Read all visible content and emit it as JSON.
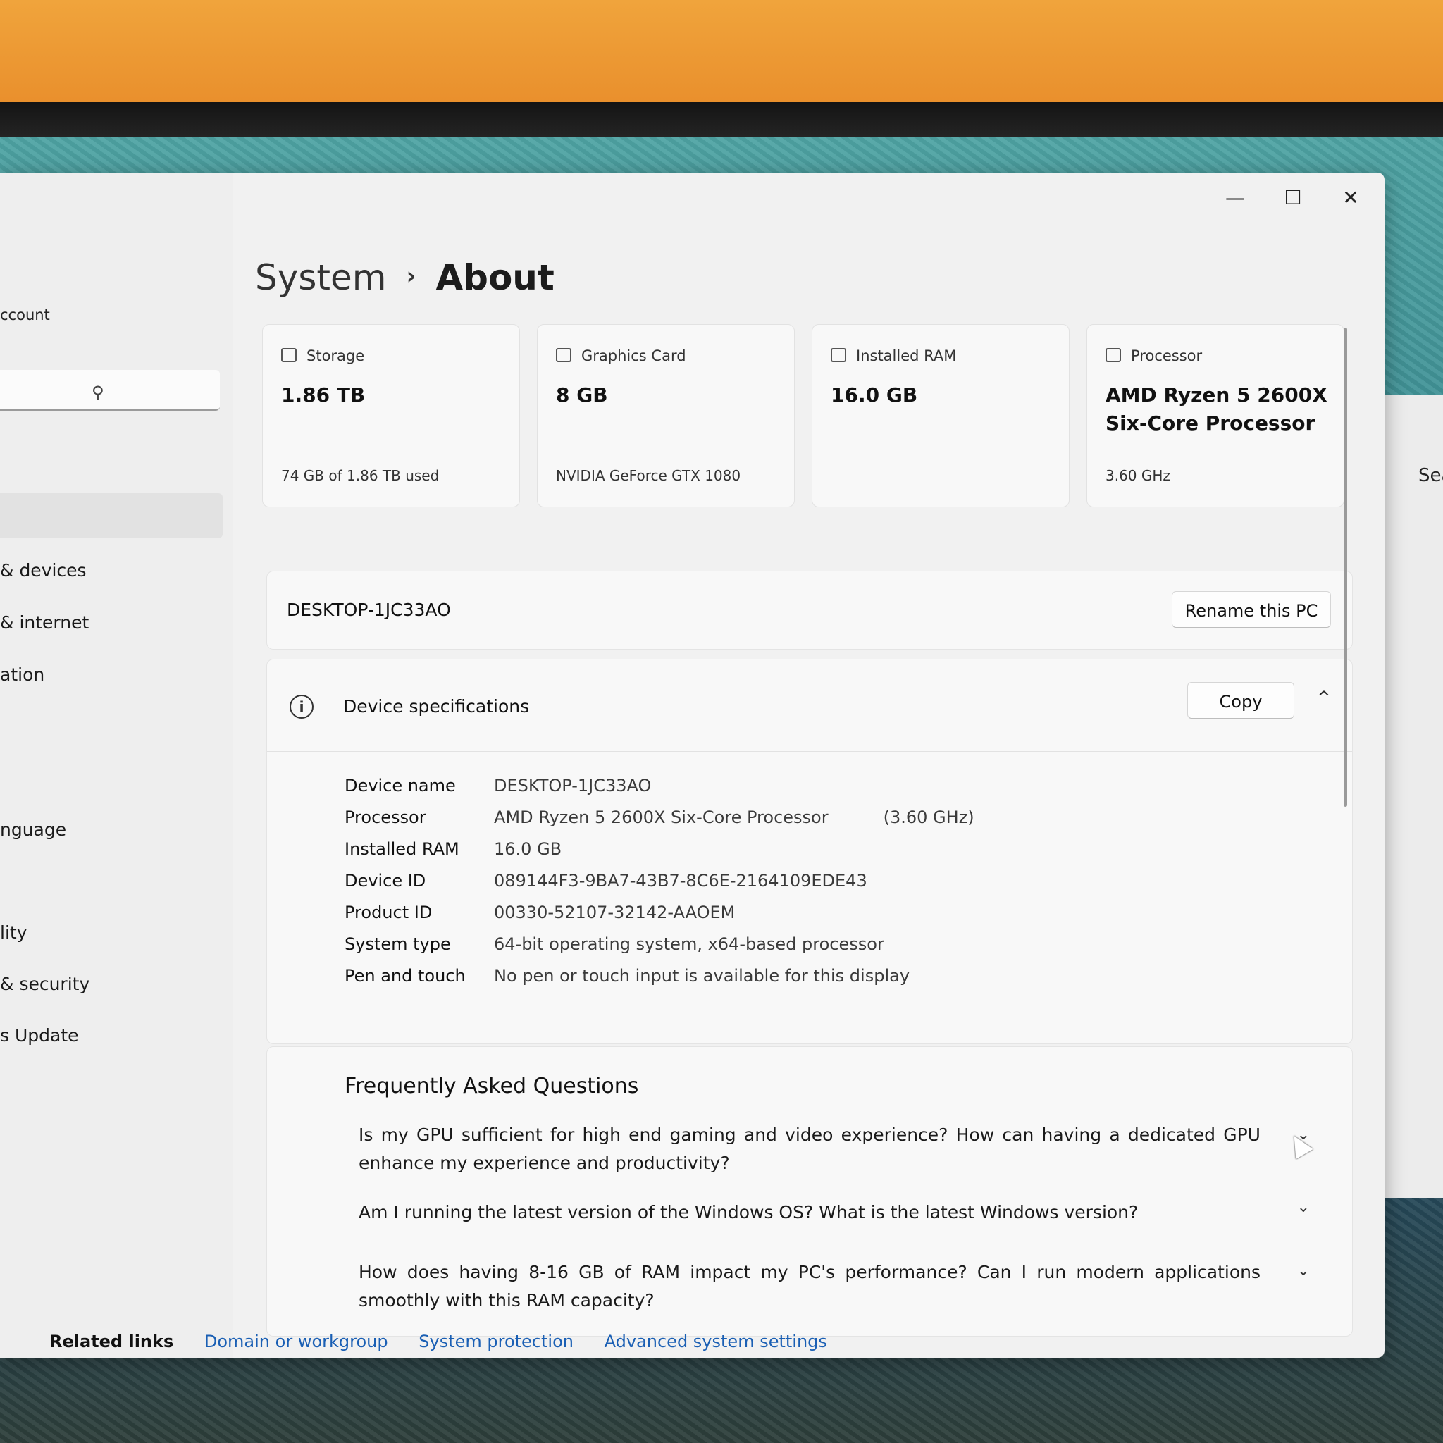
{
  "sidebar": {
    "account": "ccount",
    "items": [
      "& devices",
      "& internet",
      "ation",
      "nguage",
      "lity",
      "& security",
      "s Update"
    ]
  },
  "behind_window": {
    "text": "Sea"
  },
  "breadcrumb": {
    "parent": "System",
    "separator": "›",
    "current": "About"
  },
  "caption": {
    "minimize": "—",
    "maximize": "☐",
    "close": "✕"
  },
  "cards": [
    {
      "label": "Storage",
      "value": "1.86 TB",
      "sub": "74 GB of 1.86 TB used"
    },
    {
      "label": "Graphics Card",
      "value": "8 GB",
      "sub": "NVIDIA GeForce GTX 1080"
    },
    {
      "label": "Installed RAM",
      "value": "16.0 GB",
      "sub": ""
    },
    {
      "label": "Processor",
      "value": "AMD Ryzen 5 2600X Six-Core Processor",
      "sub": "3.60 GHz"
    }
  ],
  "pc_name": {
    "name": "DESKTOP-1JC33AO",
    "rename_label": "Rename this PC"
  },
  "device_specs": {
    "title": "Device specifications",
    "copy_label": "Copy",
    "chevron": "^",
    "rows": [
      {
        "key": "Device name",
        "value": "DESKTOP-1JC33AO",
        "extra": ""
      },
      {
        "key": "Processor",
        "value": "AMD Ryzen 5 2600X Six-Core Processor",
        "extra": "(3.60 GHz)"
      },
      {
        "key": "Installed RAM",
        "value": "16.0 GB",
        "extra": ""
      },
      {
        "key": "Device ID",
        "value": "089144F3-9BA7-43B7-8C6E-2164109EDE43",
        "extra": ""
      },
      {
        "key": "Product ID",
        "value": "00330-52107-32142-AAOEM",
        "extra": ""
      },
      {
        "key": "System type",
        "value": "64-bit operating system, x64-based processor",
        "extra": ""
      },
      {
        "key": "Pen and touch",
        "value": "No pen or touch input is available for this display",
        "extra": ""
      }
    ]
  },
  "faq": {
    "title": "Frequently Asked Questions",
    "chevron": "⌄",
    "questions": [
      "Is my GPU sufficient for high end gaming and video experience? How can having a dedicated GPU enhance my experience and productivity?",
      "Am I running the latest version of the Windows OS? What is the latest Windows version?",
      "How does having 8-16 GB of RAM impact my PC's performance? Can I run modern applications smoothly with this RAM capacity?"
    ]
  },
  "related_links": {
    "label": "Related links",
    "links": [
      "Domain or workgroup",
      "System protection",
      "Advanced system settings"
    ]
  },
  "colors": {
    "accent": "#1a5fb4",
    "window_bg": "#f1f1f1",
    "card_bg": "#f8f8f8"
  }
}
